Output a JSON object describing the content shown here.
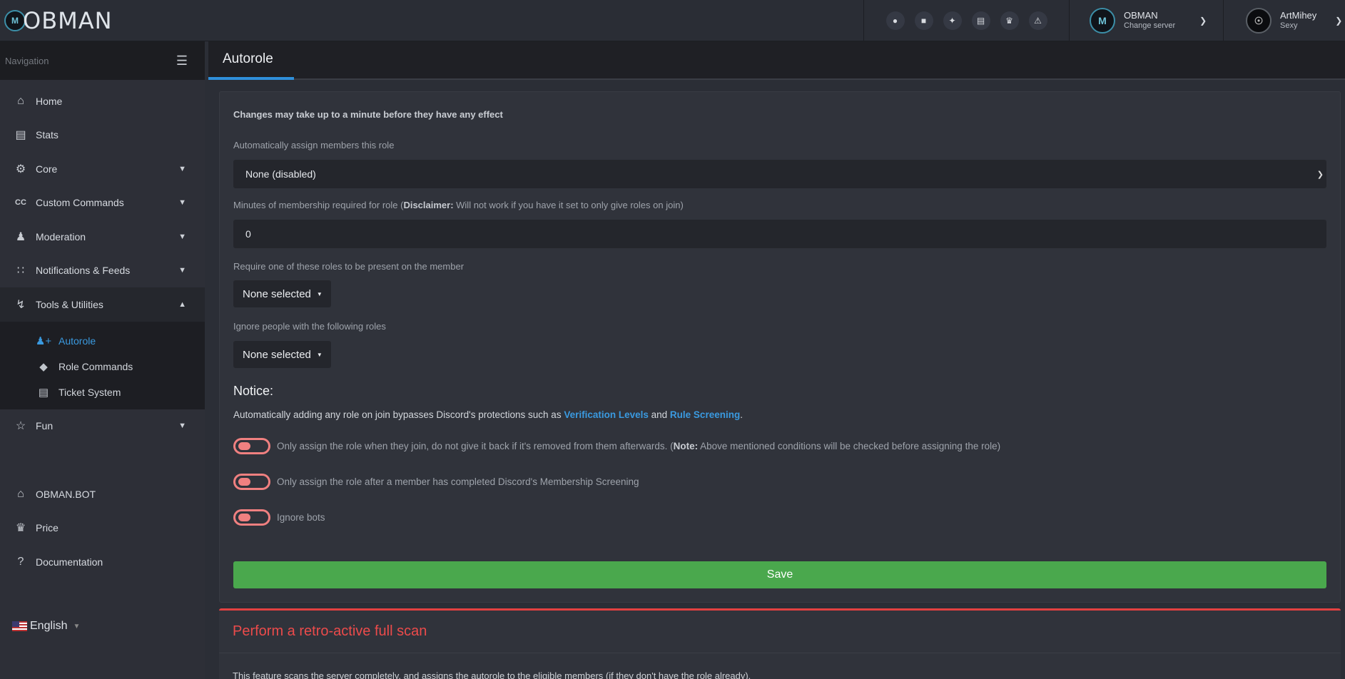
{
  "logo": {
    "text": "OBMAN"
  },
  "topbar": {
    "icons": [
      "lightbulb-icon",
      "discord-icon",
      "twitter-icon",
      "ticket-icon",
      "crown-icon",
      "warning-icon"
    ],
    "server": {
      "name": "OBMAN",
      "action": "Change server"
    },
    "user": {
      "name": "ArtMihey",
      "status": "Sexy"
    }
  },
  "sidebar": {
    "header": "Navigation",
    "items": [
      {
        "label": "Home",
        "icon": "home-icon"
      },
      {
        "label": "Stats",
        "icon": "chart-icon"
      },
      {
        "label": "Core",
        "icon": "gears-icon"
      },
      {
        "label": "Custom Commands",
        "icon": "cc-icon"
      },
      {
        "label": "Moderation",
        "icon": "user-shield-icon"
      },
      {
        "label": "Notifications & Feeds",
        "icon": "rss-icon"
      },
      {
        "label": "Tools & Utilities",
        "icon": "bolt-icon"
      }
    ],
    "subitems": [
      {
        "label": "Autorole",
        "icon": "user-plus-icon",
        "active": true
      },
      {
        "label": "Role Commands",
        "icon": "tags-icon"
      },
      {
        "label": "Ticket System",
        "icon": "ticket-icon"
      }
    ],
    "fun": {
      "label": "Fun",
      "icon": "trophy-icon"
    },
    "links": [
      {
        "label": "OBMAN.BOT",
        "icon": "home-icon"
      },
      {
        "label": "Price",
        "icon": "crown-icon"
      },
      {
        "label": "Documentation",
        "icon": "question-icon"
      }
    ],
    "language": "English"
  },
  "page": {
    "tab": "Autorole"
  },
  "form": {
    "top_notice": "Changes may take up to a minute before they have any effect",
    "role_label": "Automatically assign members this role",
    "role_value": "None (disabled)",
    "minutes_label_prefix": "Minutes of membership required for role (",
    "minutes_label_bold": "Disclaimer:",
    "minutes_label_suffix": " Will not work if you have it set to only give roles on join)",
    "minutes_value": "0",
    "require_label": "Require one of these roles to be present on the member",
    "require_value": "None selected",
    "ignore_label": "Ignore people with the following roles",
    "ignore_value": "None selected",
    "notice_heading": "Notice:",
    "notice_text_prefix": "Automatically adding any role on join bypasses Discord's protections such as ",
    "notice_link1": "Verification Levels",
    "notice_and": " and ",
    "notice_link2": "Rule Screening",
    "notice_end": ".",
    "toggle1_prefix": "Only assign the role when they join, do not give it back if it's removed from them afterwards. (",
    "toggle1_bold": "Note:",
    "toggle1_suffix": " Above mentioned conditions will be checked before assigning the role)",
    "toggle2": "Only assign the role after a member has completed Discord's Membership Screening",
    "toggle3": "Ignore bots",
    "save": "Save"
  },
  "scan": {
    "title": "Perform a retro-active full scan",
    "text": "This feature scans the server completely, and assigns the autorole to the eligible members (if they don't have the role already)."
  }
}
